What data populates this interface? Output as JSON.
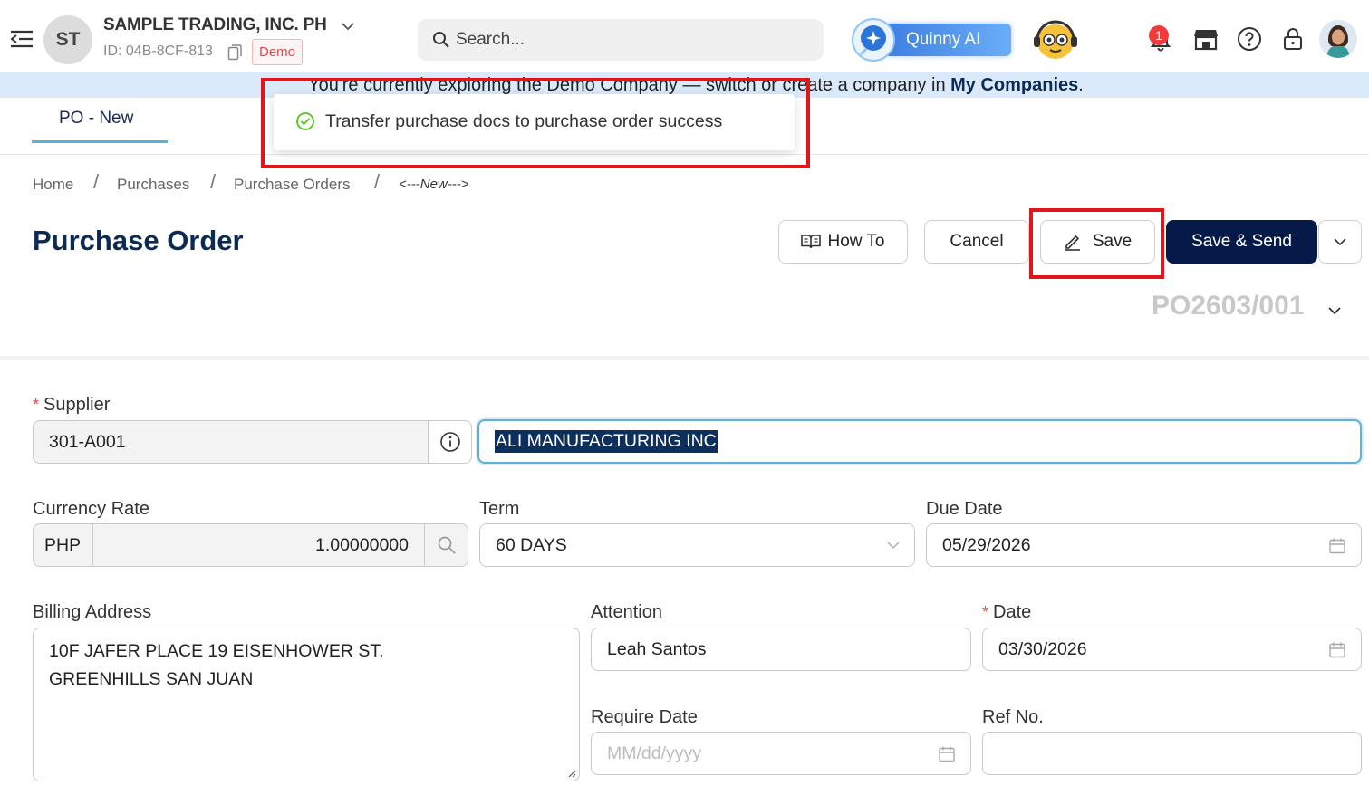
{
  "header": {
    "company_initials": "ST",
    "company_name": "SAMPLE TRADING, INC. PH",
    "company_id": "ID: 04B-8CF-813",
    "demo_badge": "Demo",
    "search_placeholder": "Search...",
    "ai_label": "Quinny AI",
    "notification_count": "1"
  },
  "banner": {
    "text_before": "You're currently exploring the Demo Company — switch or create a company in ",
    "link": "My Companies",
    "text_after": "."
  },
  "tabs": [
    {
      "label": "PO - New"
    }
  ],
  "toast": {
    "message": "Transfer purchase docs to purchase order success"
  },
  "breadcrumb": [
    "Home",
    "Purchases",
    "Purchase Orders",
    "<---New--->"
  ],
  "page_title": "Purchase Order",
  "actions": {
    "how_to": "How To",
    "cancel": "Cancel",
    "save": "Save",
    "save_send": "Save & Send"
  },
  "doc_number": "PO2603/001",
  "form": {
    "supplier": {
      "label": "Supplier",
      "code": "301-A001",
      "name": "ALI MANUFACTURING INC"
    },
    "currency_rate": {
      "label": "Currency Rate",
      "currency": "PHP",
      "rate": "1.00000000"
    },
    "term": {
      "label": "Term",
      "value": "60 DAYS"
    },
    "due_date": {
      "label": "Due Date",
      "value": "05/29/2026"
    },
    "billing_address": {
      "label": "Billing Address",
      "line1": "10F JAFER PLACE 19 EISENHOWER ST.",
      "line2": "GREENHILLS SAN JUAN"
    },
    "attention": {
      "label": "Attention",
      "value": "Leah Santos"
    },
    "date": {
      "label": "Date",
      "value": "03/30/2026"
    },
    "require_date": {
      "label": "Require Date",
      "placeholder": "MM/dd/yyyy"
    },
    "ref_no": {
      "label": "Ref No.",
      "value": ""
    }
  },
  "colors": {
    "brand": "#0d2a55",
    "primary_button": "#061a4a",
    "banner": "#dbeafb",
    "highlight": "#e1161b"
  }
}
